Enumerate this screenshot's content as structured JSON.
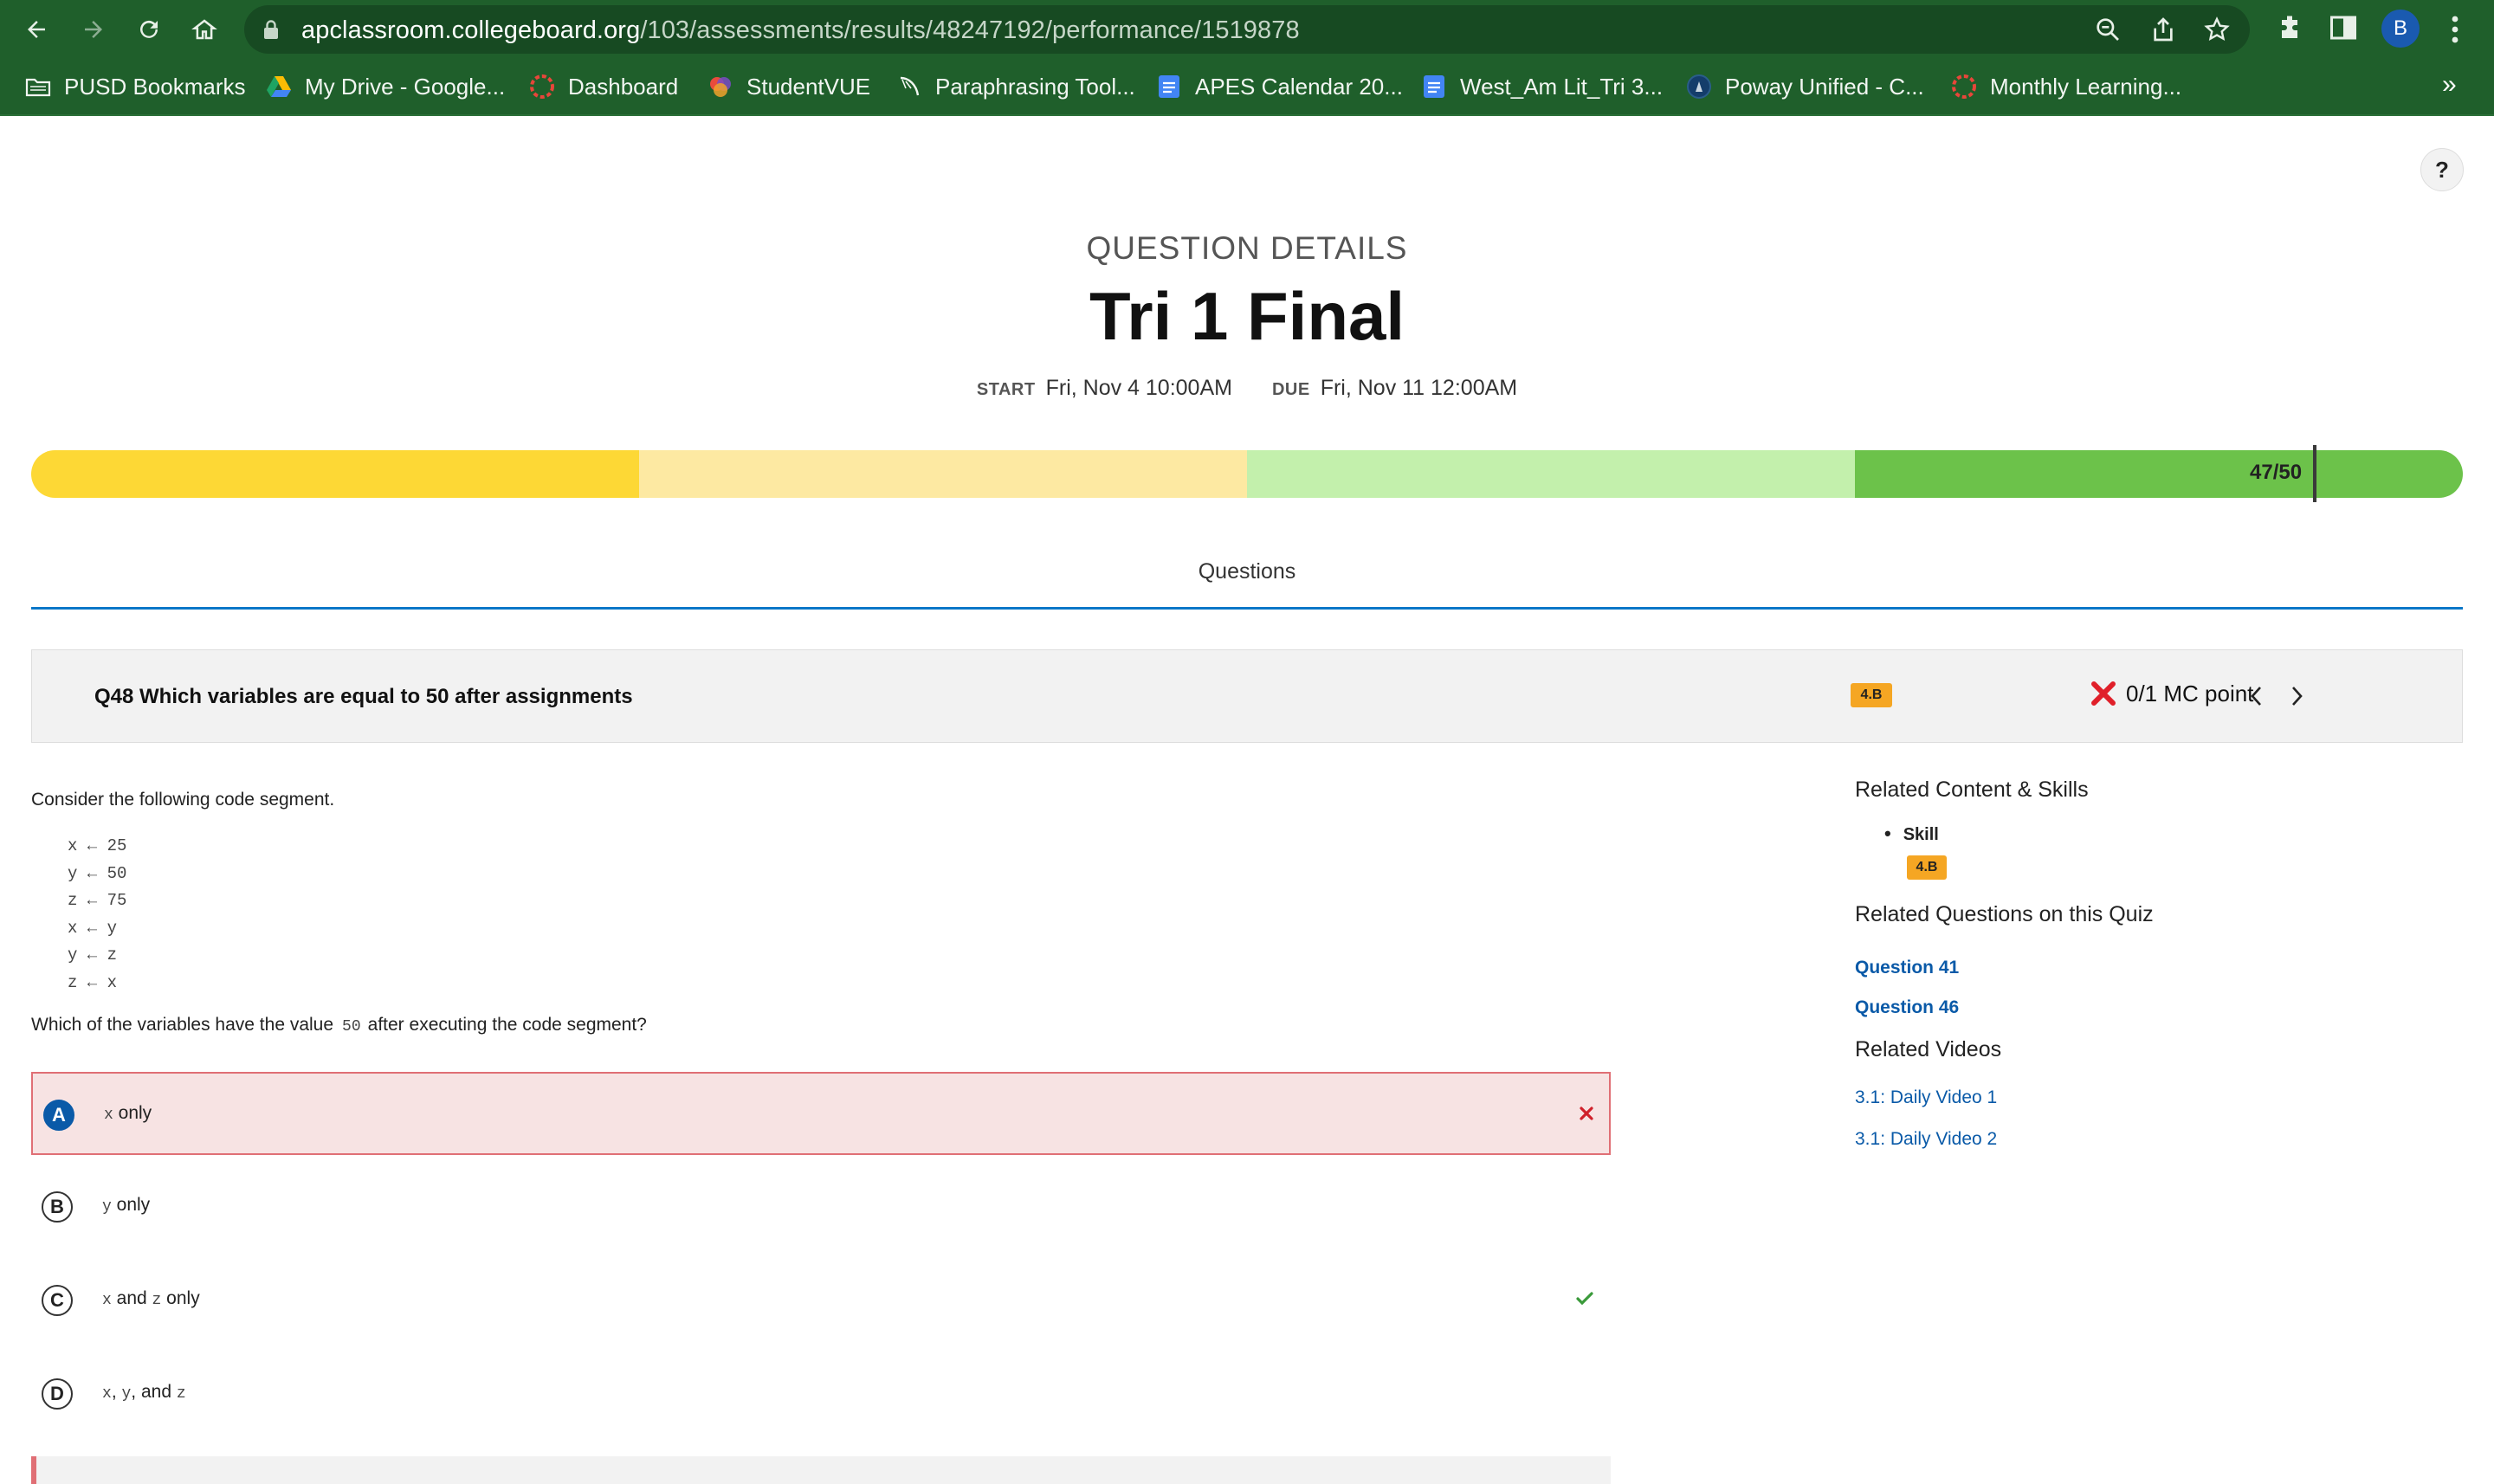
{
  "browser": {
    "url_host": "apclassroom.collegeboard.org",
    "url_path": "/103/assessments/results/48247192/performance/1519878",
    "profile_initial": "B",
    "bookmarks": [
      {
        "label": "PUSD Bookmarks",
        "icon": "folder-icon"
      },
      {
        "label": "My Drive - Google...",
        "icon": "google-drive-icon"
      },
      {
        "label": "Dashboard",
        "icon": "dashboard-icon"
      },
      {
        "label": "StudentVUE",
        "icon": "studentvue-icon"
      },
      {
        "label": "Paraphrasing Tool...",
        "icon": "feather-icon"
      },
      {
        "label": "APES Calendar 20...",
        "icon": "google-docs-icon"
      },
      {
        "label": "West_Am Lit_Tri 3...",
        "icon": "google-docs-icon"
      },
      {
        "label": "Poway Unified - C...",
        "icon": "district-seal-icon"
      },
      {
        "label": "Monthly Learning...",
        "icon": "dashboard-icon"
      }
    ],
    "more_bookmarks": "»"
  },
  "page": {
    "help_label": "?",
    "header_kicker": "QUESTION DETAILS",
    "title": "Tri 1 Final",
    "start_label": "START",
    "start_value": "Fri, Nov 4 10:00AM",
    "due_label": "DUE",
    "due_value": "Fri, Nov 11 12:00AM",
    "score_text": "47/50",
    "score_fraction": 0.94,
    "progress_colors": [
      "#fdd835",
      "#fde9a2",
      "#c3f0ac",
      "#6cc24a"
    ],
    "tab_label": "Questions"
  },
  "question": {
    "title": "Q48 Which variables are equal to 50 after assignments",
    "skill_badge": "4.B",
    "score": "0/1 MC point",
    "status": "incorrect",
    "intro": "Consider the following code segment.",
    "code_lines": [
      "x ← 25",
      "y ← 50",
      "z ← 75",
      "x ← y",
      "y ← z",
      "z ← x"
    ],
    "prompt_before": "Which of the variables have the value",
    "prompt_code": "50",
    "prompt_after": "after executing the code segment?",
    "options": [
      {
        "letter": "A",
        "parts": [
          "x",
          " only"
        ],
        "selected": true,
        "mark": "wrong"
      },
      {
        "letter": "B",
        "parts": [
          "y",
          " only"
        ],
        "selected": false,
        "mark": ""
      },
      {
        "letter": "C",
        "parts": [
          "x",
          " and ",
          "z",
          " only"
        ],
        "selected": false,
        "mark": "correct"
      },
      {
        "letter": "D",
        "parts": [
          "x",
          ", ",
          "y",
          ", and ",
          "z"
        ],
        "selected": false,
        "mark": ""
      }
    ]
  },
  "sidebar": {
    "related_heading": "Related Content & Skills",
    "skill_label": "Skill",
    "skill_badge": "4.B",
    "questions_heading": "Related Questions on this Quiz",
    "questions": [
      "Question 41",
      "Question 46"
    ],
    "videos_heading": "Related Videos",
    "videos": [
      "3.1: Daily Video 1",
      "3.1: Daily Video 2"
    ]
  }
}
